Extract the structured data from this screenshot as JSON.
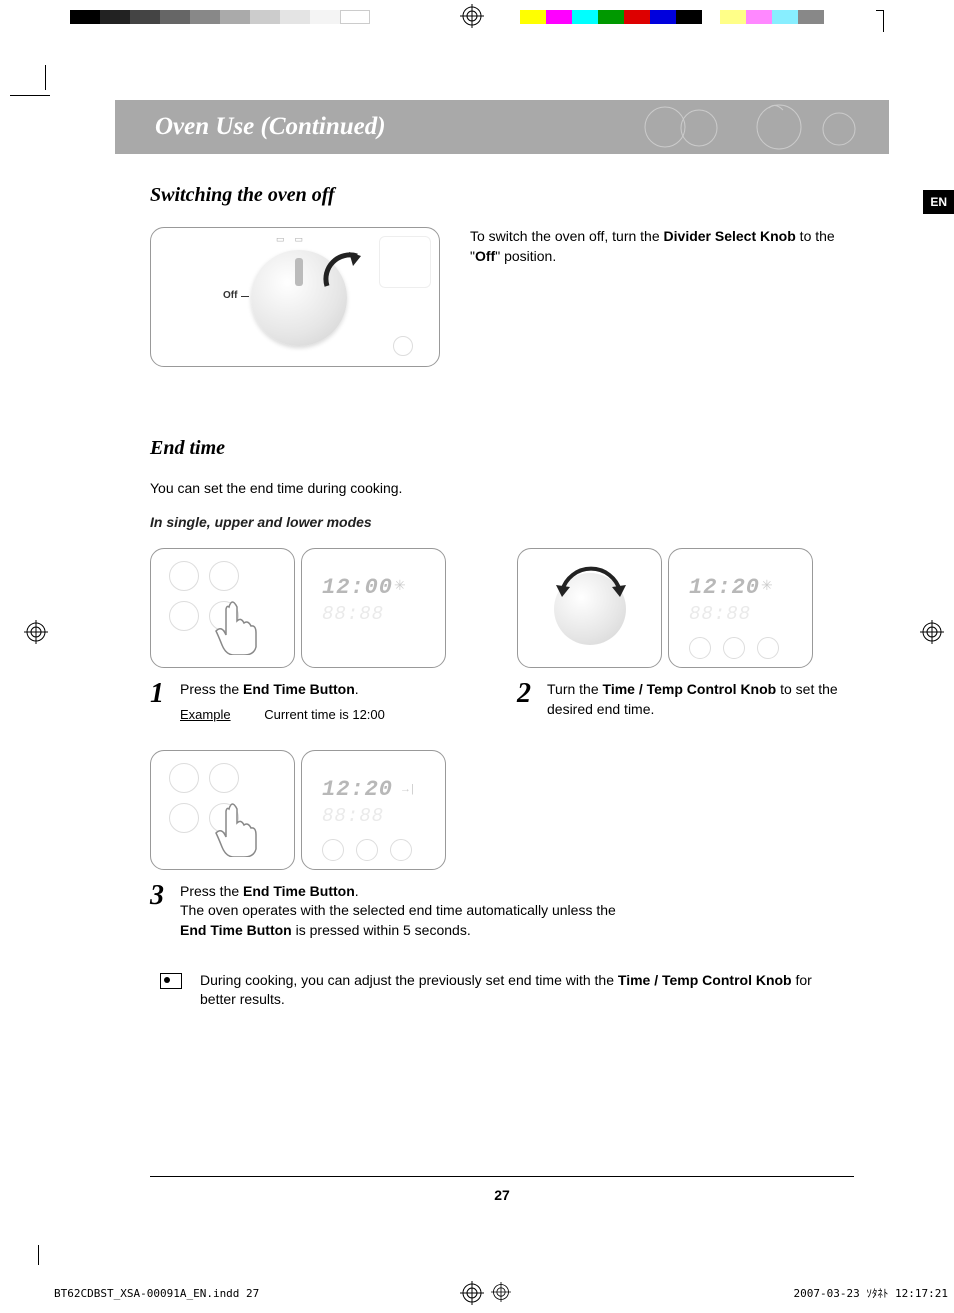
{
  "lang_badge": "EN",
  "header": {
    "title": "Oven Use (Continued)"
  },
  "section_switch_off": {
    "title": "Switching the oven off",
    "off_label": "Off",
    "text_before": "To switch the oven off, turn the ",
    "text_bold": "Divider Select Knob",
    "text_mid": " to the \"",
    "text_bold2": "Off",
    "text_after": "\" position."
  },
  "section_end_time": {
    "title": "End time",
    "desc": "You can set the end time during cooking.",
    "sub": "In single, upper and lower modes",
    "step1": {
      "num": "1",
      "text_before": "Press the ",
      "text_bold": "End Time Button",
      "text_after": ".",
      "example_label": "Example",
      "example_text": "Current time is 12:00",
      "display": "12:00",
      "display_secondary": "88:88"
    },
    "step2": {
      "num": "2",
      "text_before": "Turn the ",
      "text_bold": "Time / Temp Control Knob",
      "text_after": " to set the desired end time.",
      "display": "12:20",
      "display_secondary": "88:88"
    },
    "step3": {
      "num": "3",
      "text_before": "Press the ",
      "text_bold": "End Time Button",
      "text_mid": ".\nThe oven operates with the selected end time automatically unless the ",
      "text_bold2": "End Time Button",
      "text_after": " is pressed within 5 seconds.",
      "display": "12:20",
      "display_secondary": "88:88"
    },
    "note": {
      "text_before": "During cooking, you can adjust the previously set end time with the ",
      "text_bold": "Time / Temp Control Knob",
      "text_after": " for better results."
    }
  },
  "page_number": "27",
  "imprint": {
    "left": "BT62CDBST_XSA-00091A_EN.indd   27",
    "right": "2007-03-23   ｿﾀﾈﾄ 12:17:21"
  }
}
